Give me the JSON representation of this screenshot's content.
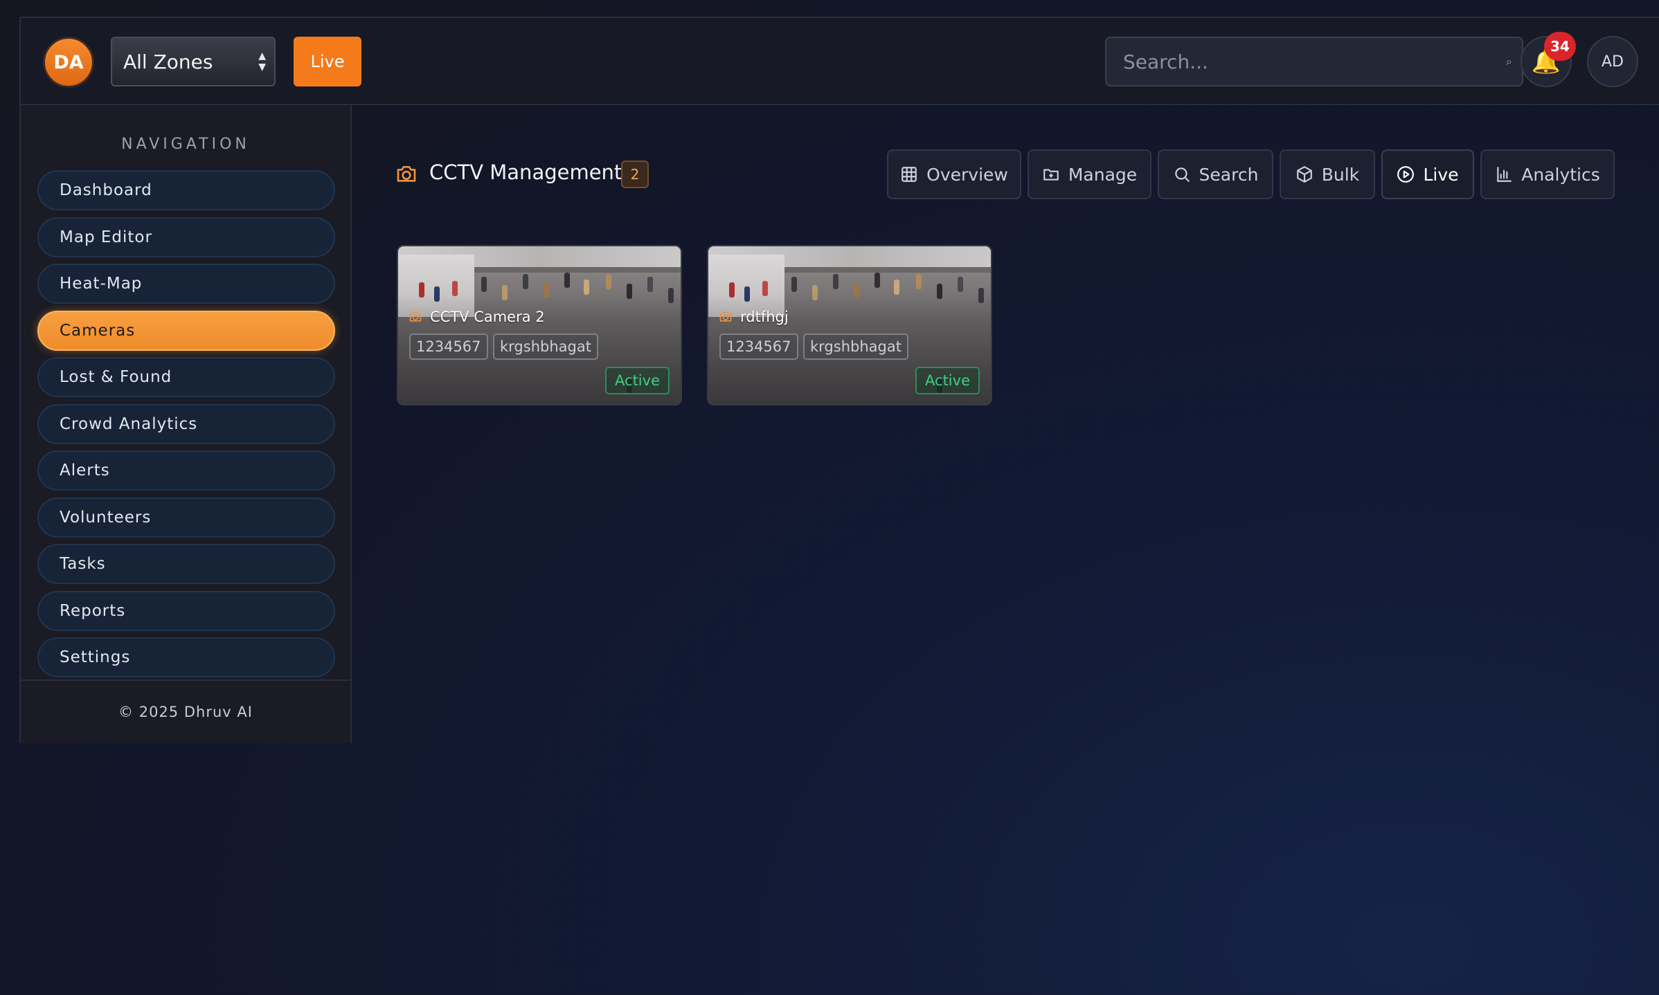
{
  "header": {
    "brand_initials": "DA",
    "zone_select": {
      "selected": "All Zones"
    },
    "live_label": "Live",
    "search": {
      "placeholder": "Search...",
      "value": ""
    },
    "notifications_count": "34",
    "user_initials": "AD"
  },
  "sidebar": {
    "title": "NAVIGATION",
    "items": [
      {
        "label": "Dashboard",
        "active": false
      },
      {
        "label": "Map Editor",
        "active": false
      },
      {
        "label": "Heat-Map",
        "active": false
      },
      {
        "label": "Cameras",
        "active": true
      },
      {
        "label": "Lost & Found",
        "active": false
      },
      {
        "label": "Crowd Analytics",
        "active": false
      },
      {
        "label": "Alerts",
        "active": false
      },
      {
        "label": "Volunteers",
        "active": false
      },
      {
        "label": "Tasks",
        "active": false
      },
      {
        "label": "Reports",
        "active": false
      },
      {
        "label": "Settings",
        "active": false
      }
    ],
    "footer": "© 2025 Dhruv AI"
  },
  "main": {
    "title": "CCTV Management",
    "count": "2",
    "tabs": [
      {
        "label": "Overview",
        "icon": "grid-icon"
      },
      {
        "label": "Manage",
        "icon": "folder-plus-icon"
      },
      {
        "label": "Search",
        "icon": "search-icon"
      },
      {
        "label": "Bulk",
        "icon": "box-icon"
      },
      {
        "label": "Live",
        "icon": "play-circle-icon",
        "active": true
      },
      {
        "label": "Analytics",
        "icon": "bar-chart-icon"
      }
    ],
    "cameras": [
      {
        "name": "CCTV Camera 2",
        "tags": [
          "1234567",
          "krgshbhagat"
        ],
        "status": "Active"
      },
      {
        "name": "rdtfhgj",
        "tags": [
          "1234567",
          "krgshbhagat"
        ],
        "status": "Active"
      }
    ]
  },
  "colors": {
    "accent": "#f47a1a",
    "active_nav": "#f39a3c",
    "status_active": "#3fcf7e",
    "badge": "#d9252b"
  }
}
